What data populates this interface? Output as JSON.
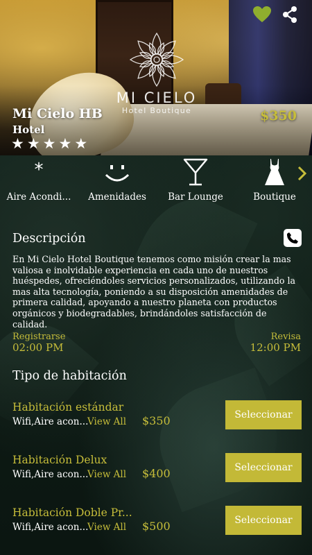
{
  "hotel": {
    "name": "Mi Cielo HB",
    "type": "Hotel",
    "rating": 5,
    "price": "$350",
    "logo_name": "MI CIELO",
    "logo_sub": "Hotel Boutique",
    "favorite_color": "#8fae2e"
  },
  "stars": [
    "★",
    "★",
    "★",
    "★",
    "★"
  ],
  "amenities": [
    {
      "label": "Aire Acondi...",
      "icon": "asterisk-icon"
    },
    {
      "label": "Amenidades",
      "icon": "smiley-icon"
    },
    {
      "label": "Bar Lounge",
      "icon": "martini-glass-icon"
    },
    {
      "label": "Boutique",
      "icon": "dress-icon"
    }
  ],
  "description": {
    "title": "Descripción",
    "text": "En Mi Cielo Hotel Boutique tenemos como misión crear la mas valiosa e inolvidable experiencia en cada uno de nuestros huéspedes, ofreciéndoles servicios personalizados, utilizando la mas alta tecnología, poniendo a su disposición amenidades de primera calidad, apoyando a nuestro planeta con productos orgánicos y biodegradables, brindándoles satisfacción de calidad."
  },
  "checkin": {
    "label": "Registrarse",
    "time": "02:00 PM"
  },
  "checkout": {
    "label": "Revisa",
    "time": "12:00 PM"
  },
  "rooms_title": "Tipo de habitación",
  "rooms": [
    {
      "name": "Habitación estándar",
      "amenities": "Wifi,Aire acon...",
      "view_all": "View All",
      "price": "$350",
      "button": "Seleccionar"
    },
    {
      "name": "Habitación Delux",
      "amenities": "Wifi,Aire acon...",
      "view_all": "View All",
      "price": "$400",
      "button": "Seleccionar"
    },
    {
      "name": "Habitación Doble Pr...",
      "amenities": "Wifi,Aire acon...",
      "view_all": "View All",
      "price": "$500",
      "button": "Seleccionar"
    }
  ],
  "colors": {
    "accent": "#c6bd3a",
    "button": "#c3b937",
    "background": "#0f1d16"
  }
}
